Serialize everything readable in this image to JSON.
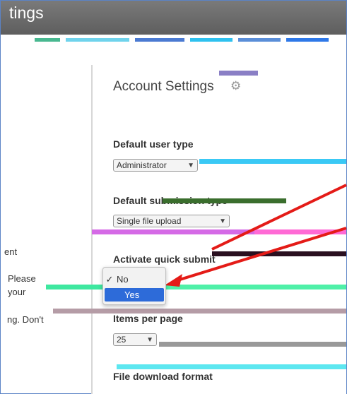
{
  "window": {
    "title": "tings"
  },
  "left_text": [
    "ent",
    "Please",
    "your",
    "ng. Don't"
  ],
  "panel": {
    "title": "Account Settings",
    "gear_icon": "gear-icon",
    "sections": {
      "default_user_type": {
        "label": "Default user type",
        "value": "Administrator"
      },
      "submission_type": {
        "label": "Default submission type",
        "value": "Single file upload"
      },
      "quick_submit": {
        "label": "Activate quick submit",
        "options": [
          "No",
          "Yes"
        ],
        "checked": "No",
        "highlighted": "Yes"
      },
      "items_per_page": {
        "label": "Items per page",
        "value": "25"
      },
      "file_download_format": {
        "label": "File download format"
      }
    }
  },
  "colors": {
    "highlight": "#2d6bd9",
    "arrow": "#e41b17",
    "frame": "#5b83c6"
  }
}
